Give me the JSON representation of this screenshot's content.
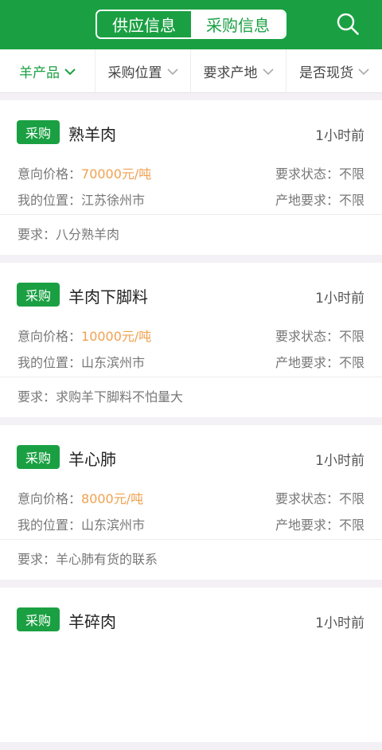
{
  "header": {
    "tab_supply": "供应信息",
    "tab_purchase": "采购信息",
    "search_icon": "search-icon"
  },
  "filters": [
    {
      "label": "羊产品"
    },
    {
      "label": "采购位置"
    },
    {
      "label": "要求产地"
    },
    {
      "label": "是否现货"
    }
  ],
  "colors": {
    "accent": "#1aa042",
    "price": "#f0a150"
  },
  "labels": {
    "price": "意向价格：",
    "location": "我的位置：",
    "status": "要求状态：",
    "origin": "产地要求：",
    "requirement": "要求："
  },
  "listings": [
    {
      "badge": "采购",
      "title": "熟羊肉",
      "time": "1小时前",
      "price": "70000元/吨",
      "location": "江苏徐州市",
      "status": "不限",
      "origin": "不限",
      "requirement": "八分熟羊肉"
    },
    {
      "badge": "采购",
      "title": "羊肉下脚料",
      "time": "1小时前",
      "price": "10000元/吨",
      "location": "山东滨州市",
      "status": "不限",
      "origin": "不限",
      "requirement": "求购羊下脚料不怕量大"
    },
    {
      "badge": "采购",
      "title": "羊心肺",
      "time": "1小时前",
      "price": "8000元/吨",
      "location": "山东滨州市",
      "status": "不限",
      "origin": "不限",
      "requirement": "羊心肺有货的联系"
    },
    {
      "badge": "采购",
      "title": "羊碎肉",
      "time": "1小时前"
    }
  ]
}
